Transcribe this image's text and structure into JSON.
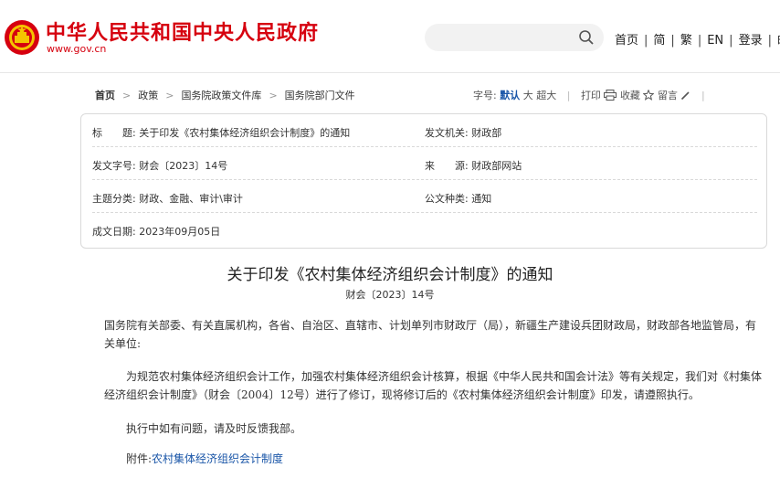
{
  "header": {
    "site_title": "中华人民共和国中央人民政府",
    "site_url": "www.gov.cn",
    "search_placeholder": "",
    "links": [
      "首页",
      "简",
      "繁",
      "EN",
      "登录",
      "邮"
    ],
    "brand_color": "#d6000f"
  },
  "breadcrumb": {
    "items": [
      "首页",
      "政策",
      "国务院政策文件库",
      "国务院部门文件"
    ]
  },
  "tools": {
    "font_label": "字号:",
    "font_default": "默认",
    "font_large": "大",
    "font_xlarge": "超大",
    "print": "打印",
    "favorite": "收藏",
    "comment": "留言"
  },
  "info": {
    "title_label": "标　　题:",
    "title_value": "关于印发《农村集体经济组织会计制度》的通知",
    "issuer_label": "发文机关:",
    "issuer_value": "财政部",
    "docno_label": "发文字号:",
    "docno_value": "财会〔2023〕14号",
    "source_label": "来　　源:",
    "source_value": "财政部网站",
    "topic_label": "主题分类:",
    "topic_value": "财政、金融、审计\\审计",
    "type_label": "公文种类:",
    "type_value": "通知",
    "date_label": "成文日期:",
    "date_value": "2023年09月05日"
  },
  "article": {
    "title": "关于印发《农村集体经济组织会计制度》的通知",
    "doc_number": "财会〔2023〕14号",
    "p1": "国务院有关部委、有关直属机构，各省、自治区、直辖市、计划单列市财政厅（局），新疆生产建设兵团财政局，财政部各地监管局，有关单位:",
    "p2": "为规范农村集体经济组织会计工作，加强农村集体经济组织会计核算，根据《中华人民共和国会计法》等有关规定，我们对《村集体经济组织会计制度》（财会〔2004〕12号）进行了修订，现将修订后的《农村集体经济组织会计制度》印发，请遵照执行。",
    "p3": "执行中如有问题，请及时反馈我部。",
    "attachment_label": "附件:",
    "attachment_link": "农村集体经济组织会计制度"
  }
}
